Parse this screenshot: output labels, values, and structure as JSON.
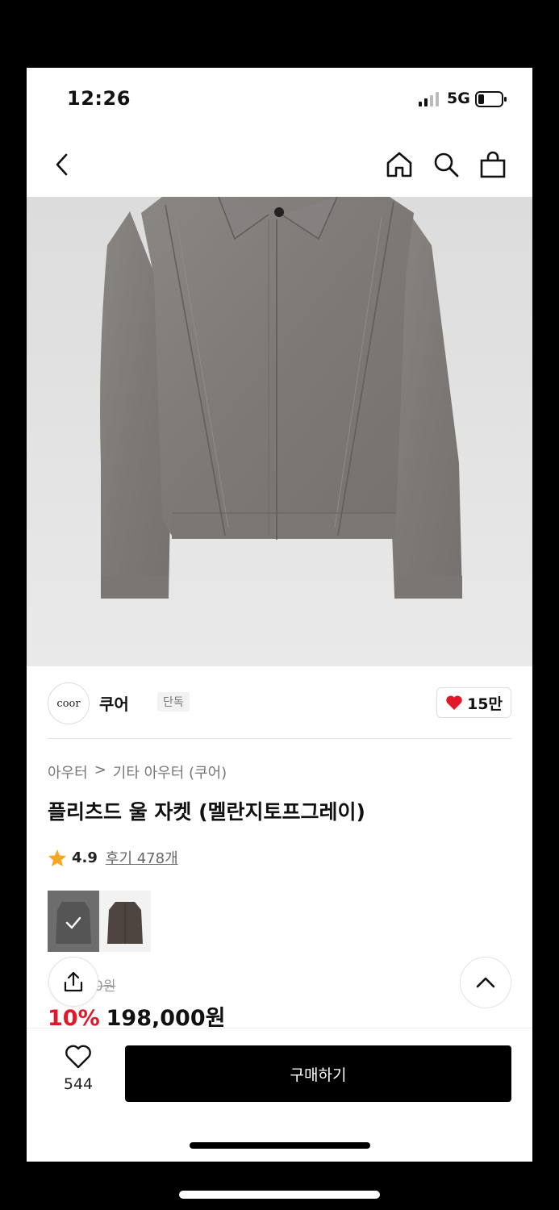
{
  "status_bar": {
    "time": "12:26",
    "network": "5G"
  },
  "nav": {
    "back_icon": "chevron-left-icon",
    "home_icon": "home-icon",
    "search_icon": "search-icon",
    "bag_icon": "shopping-bag-icon"
  },
  "brand": {
    "logo_text": "coor",
    "name": "쿠어",
    "badge": "단독",
    "like_count": "15만"
  },
  "breadcrumb": {
    "level1": "아우터",
    "separator": ">",
    "level2": "기타 아우터 (쿠어)"
  },
  "product": {
    "title": "플리츠드 울 자켓 (멜란지토프그레이)",
    "rating": "4.9",
    "reviews_label": "후기 478개",
    "original_price_partial": "0원",
    "discount": "10%",
    "price": "198,000원"
  },
  "thumbnails": [
    {
      "label": "멜란지토프그레이",
      "selected": true
    },
    {
      "label": "brown",
      "selected": false
    }
  ],
  "bottom_bar": {
    "wish_count": "544",
    "buy_label": "구매하기"
  },
  "colors": {
    "accent_red": "#e0192a",
    "heart_red": "#e0192a",
    "star": "#f5a623",
    "buy_bg": "#000000"
  }
}
